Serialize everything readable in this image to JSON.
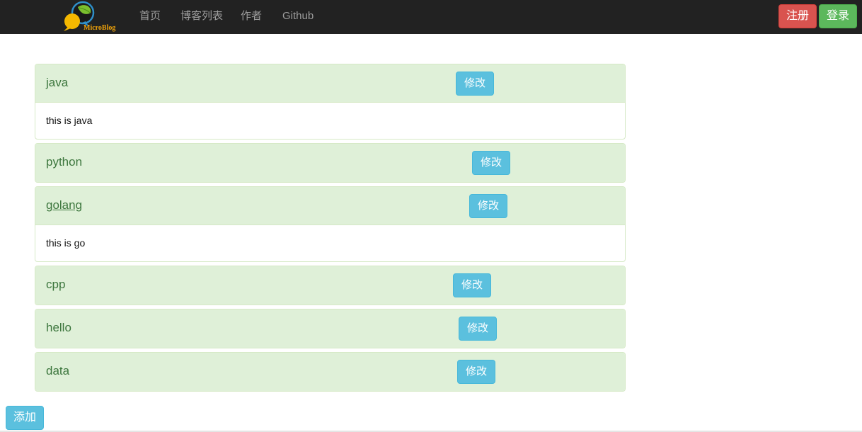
{
  "navbar": {
    "brand_text": "MicroBlog",
    "links": [
      "首页",
      "博客列表",
      "作者",
      "Github"
    ],
    "register_label": "注册",
    "login_label": "登录"
  },
  "panels": [
    {
      "title": "java",
      "body": "this is java",
      "edit_label": "修改"
    },
    {
      "title": "python",
      "body": "",
      "edit_label": "修改"
    },
    {
      "title": "golang",
      "body": "this is go",
      "edit_label": "修改"
    },
    {
      "title": "cpp",
      "body": "",
      "edit_label": "修改"
    },
    {
      "title": "hello",
      "body": "",
      "edit_label": "修改"
    },
    {
      "title": "data",
      "body": "",
      "edit_label": "修改"
    }
  ],
  "add_label": "添加",
  "colors": {
    "navbar_bg": "#222222",
    "panel_heading_bg": "#dff0d8",
    "panel_title": "#3c763d",
    "info_button": "#5bc0de",
    "danger_button": "#d9534f",
    "success_button": "#5cb85c"
  }
}
